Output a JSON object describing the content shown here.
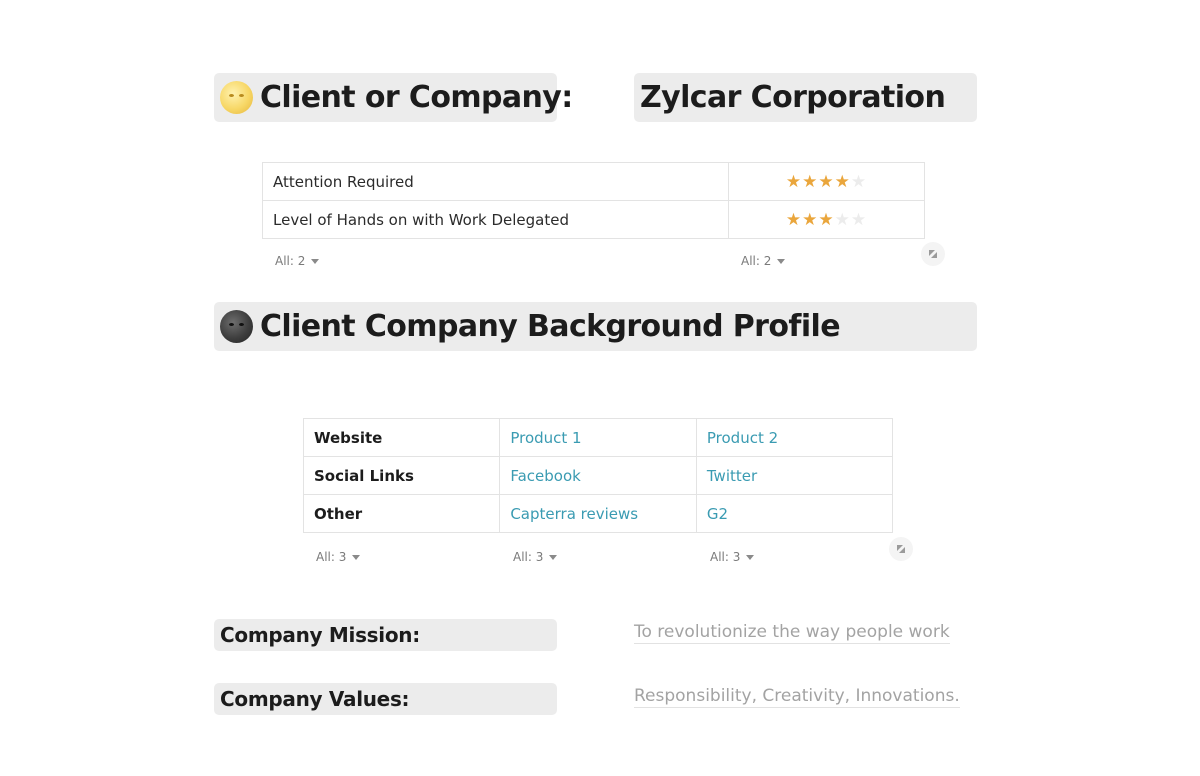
{
  "header": {
    "client_label": "Client or Company:",
    "client_value": "Zylcar Corporation"
  },
  "ratings": {
    "rows": [
      {
        "label": "Attention Required",
        "stars": 4,
        "max": 5
      },
      {
        "label": "Level of Hands on with Work Delegated",
        "stars": 3,
        "max": 5
      }
    ],
    "aggregates": [
      "All: 2",
      "All: 2"
    ]
  },
  "background": {
    "title": "Client Company Background Profile"
  },
  "links_table": {
    "rows": [
      {
        "label": "Website",
        "cells": [
          "Product 1",
          "Product 2"
        ]
      },
      {
        "label": "Social Links",
        "cells": [
          "Facebook",
          "Twitter"
        ]
      },
      {
        "label": "Other",
        "cells": [
          "Capterra reviews",
          "G2"
        ]
      }
    ],
    "aggregates": [
      "All: 3",
      "All: 3",
      "All: 3"
    ]
  },
  "mission": {
    "label": "Company Mission:",
    "value": "To revolutionize the way people work"
  },
  "values": {
    "label": "Company Values:",
    "value": "Responsibility, Creativity, Innovations."
  },
  "icons": {
    "client_emoji": "full-moon-face-icon",
    "background_emoji": "new-moon-face-icon",
    "resize": "resize-handle-icon",
    "caret": "chevron-down-icon",
    "star": "star-icon"
  },
  "colors": {
    "star_on": "#eaa63c",
    "star_off": "#ececec",
    "link": "#3a9bb2",
    "block_bg": "#ececec"
  }
}
